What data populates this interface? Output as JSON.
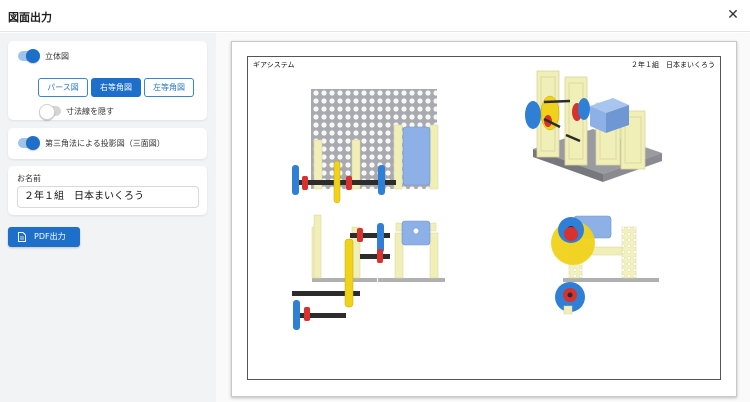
{
  "header": {
    "title": "図面出力",
    "close_icon": "close-icon"
  },
  "settings": {
    "solid_view": {
      "label": "立体図",
      "on": true
    },
    "view_options": [
      {
        "label": "パース図",
        "active": false
      },
      {
        "label": "右等角図",
        "active": true
      },
      {
        "label": "左等角図",
        "active": false
      }
    ],
    "hide_dimensions": {
      "label": "寸法線を隠す",
      "on": false
    },
    "third_angle": {
      "label": "第三角法による投影図（三面図）",
      "on": true
    },
    "name": {
      "label": "お名前",
      "value": "２年１組　日本まいくろう"
    },
    "pdf_button": {
      "label": "PDF出力",
      "icon": "document-icon"
    }
  },
  "paper": {
    "title": "ギアシステム",
    "name": "２年１組　日本まいくろう"
  },
  "colors": {
    "accent": "#1e6fc9",
    "frame": "#f1efb8",
    "grid": "#a9aab0",
    "motor": "#8db1e6",
    "gear_blue": "#2f7fd6",
    "gear_yellow": "#f0d21a",
    "gear_red": "#d7322f",
    "shaft": "#2c2c2c"
  }
}
